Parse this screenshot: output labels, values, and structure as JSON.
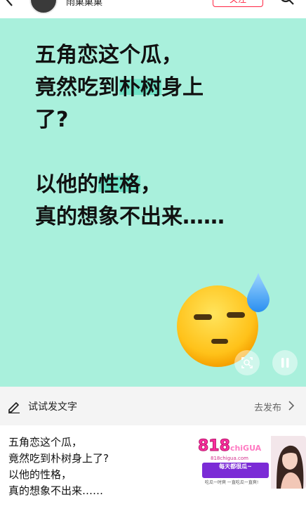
{
  "header": {
    "username": "雨菓菓菓",
    "follow_label": "关注",
    "icons": [
      "back-arrow-icon",
      "search-icon"
    ]
  },
  "card": {
    "line1": "五角恋这个瓜，",
    "line2_a": "竟然吃到",
    "line2_hl": "朴树",
    "line2_b": "身上",
    "line3": "了?",
    "line4_a": "以他的",
    "line4_hl": "性格",
    "line4_b": "，",
    "line5": "真的想象不出来……",
    "background_color": "#a9f0dc",
    "highlight_color": "#6fe3c7",
    "emoji": "sweat-expressionless-face-icon"
  },
  "composer": {
    "prompt": "试试发文字",
    "publish_label": "去发布"
  },
  "caption": {
    "lines": [
      "五角恋这个瓜，",
      "竟然吃到朴树身上了?",
      "以他的性格，",
      "真的想象不出来……"
    ]
  },
  "ad": {
    "logo": "818",
    "logo_suffix": "chiGUA",
    "url": "818chigua.com",
    "slogan": "每天都很瓜~",
    "sub": "吃瓜一时爽 一直吃瓜一直爽!"
  }
}
